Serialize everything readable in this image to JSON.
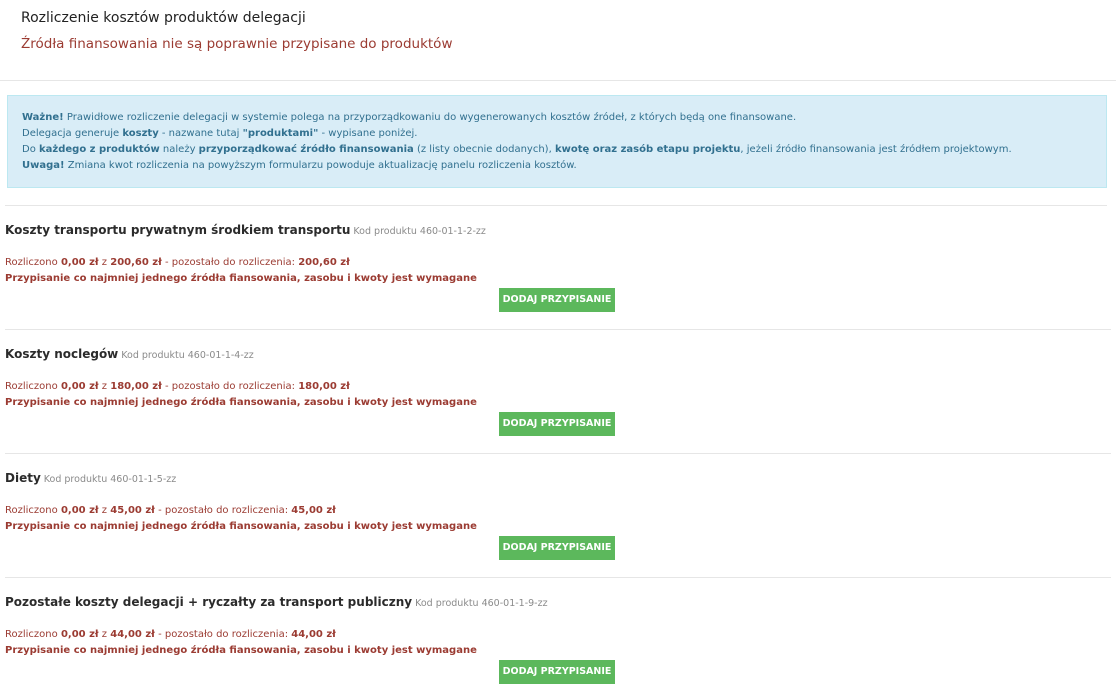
{
  "header": {
    "title": "Rozliczenie kosztów produktów delegacji",
    "subtitle": "Źródła finansowania nie są poprawnie przypisane do produktów"
  },
  "info": {
    "l1_b": "Ważne!",
    "l1_t": " Prawidłowe rozliczenie delegacji w systemie polega na przyporządkowaniu do wygenerowanych kosztów źródeł, z których będą one finansowane.",
    "l2_a": "Delegacja generuje ",
    "l2_b": "koszty",
    "l2_c": " - nazwane tutaj ",
    "l2_d": "\"produktami\"",
    "l2_e": " - wypisane poniżej.",
    "l3_a": "Do ",
    "l3_b": "każdego z produktów",
    "l3_c": " należy ",
    "l3_d": "przyporządkować źródło finansowania",
    "l3_e": " (z listy obecnie dodanych), ",
    "l3_f": "kwotę oraz zasób etapu projektu",
    "l3_g": ", jeżeli źródło finansowania jest źródłem projektowym.",
    "l4_b": "Uwaga!",
    "l4_t": " Zmiana kwot rozliczenia na powyższym formularzu powoduje aktualizację panelu rozliczenia kosztów."
  },
  "labels": {
    "settled": "Rozliczono ",
    "of": " z ",
    "remaining": " - pozostało do rozliczenia: ",
    "warning": "Przypisanie co najmniej jednego źródła fiansowania, zasobu i kwoty jest wymagane",
    "add_button": "DODAJ PRZYPISANIE"
  },
  "products": [
    {
      "name": "Koszty transportu prywatnym środkiem transportu",
      "code": "Kod produktu 460-01-1-2-zz",
      "settled": "0,00 zł",
      "total": "200,60 zł",
      "remaining": "200,60 zł"
    },
    {
      "name": "Koszty noclegów",
      "code": "Kod produktu 460-01-1-4-zz",
      "settled": "0,00 zł",
      "total": "180,00 zł",
      "remaining": "180,00 zł"
    },
    {
      "name": "Diety",
      "code": "Kod produktu 460-01-1-5-zz",
      "settled": "0,00 zł",
      "total": "45,00 zł",
      "remaining": "45,00 zł"
    },
    {
      "name": "Pozostałe koszty delegacji + ryczałty za transport publiczny",
      "code": "Kod produktu 460-01-1-9-zz",
      "settled": "0,00 zł",
      "total": "44,00 zł",
      "remaining": "44,00 zł"
    }
  ]
}
